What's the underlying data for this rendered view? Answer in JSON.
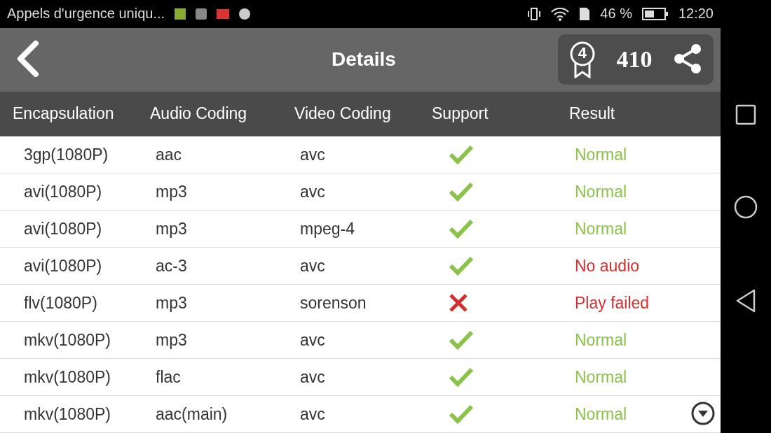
{
  "status_bar": {
    "notification": "Appels d'urgence uniqu...",
    "battery": "46 %",
    "time": "12:20"
  },
  "app_bar": {
    "title": "Details",
    "badge_level": "4",
    "score": "410"
  },
  "table": {
    "columns": [
      "Encapsulation",
      "Audio Coding",
      "Video Coding",
      "Support",
      "Result"
    ],
    "rows": [
      {
        "encapsulation": "3gp(1080P)",
        "audio": "aac",
        "video": "avc",
        "supported": true,
        "result": "Normal",
        "color": "#8bc34a"
      },
      {
        "encapsulation": "avi(1080P)",
        "audio": "mp3",
        "video": "avc",
        "supported": true,
        "result": "Normal",
        "color": "#8bc34a"
      },
      {
        "encapsulation": "avi(1080P)",
        "audio": "mp3",
        "video": "mpeg-4",
        "supported": true,
        "result": "Normal",
        "color": "#8bc34a"
      },
      {
        "encapsulation": "avi(1080P)",
        "audio": "ac-3",
        "video": "avc",
        "supported": true,
        "result": "No audio",
        "color": "#d32f2f"
      },
      {
        "encapsulation": "flv(1080P)",
        "audio": "mp3",
        "video": "sorenson",
        "supported": false,
        "result": "Play failed",
        "color": "#d32f2f"
      },
      {
        "encapsulation": "mkv(1080P)",
        "audio": "mp3",
        "video": "avc",
        "supported": true,
        "result": "Normal",
        "color": "#8bc34a"
      },
      {
        "encapsulation": "mkv(1080P)",
        "audio": "flac",
        "video": "avc",
        "supported": true,
        "result": "Normal",
        "color": "#8bc34a"
      },
      {
        "encapsulation": "mkv(1080P)",
        "audio": "aac(main)",
        "video": "avc",
        "supported": true,
        "result": "Normal",
        "color": "#8bc34a"
      }
    ]
  }
}
